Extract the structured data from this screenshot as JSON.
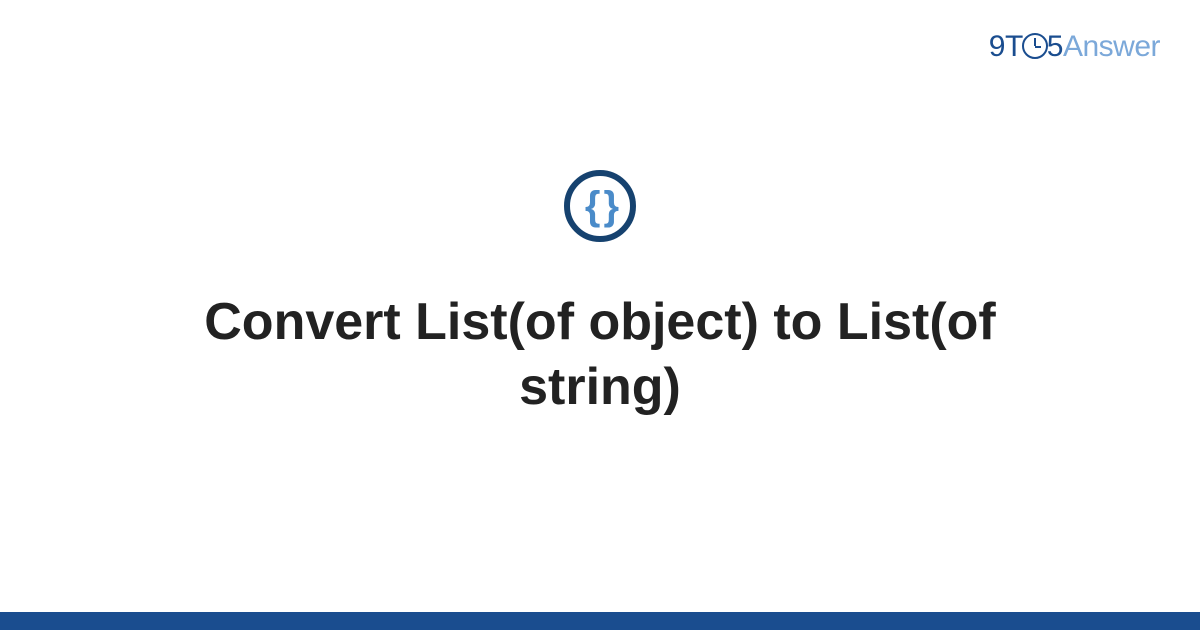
{
  "brand": {
    "part1": "9",
    "part2": "T",
    "part3": "5",
    "part4": "Answer"
  },
  "category_icon": {
    "symbol": "{ }",
    "name": "code-braces"
  },
  "title": "Convert List(of object) to List(of string)",
  "colors": {
    "brand_primary": "#1a4d8f",
    "brand_secondary": "#7ba8d9",
    "icon_border": "#16426f",
    "icon_fill": "#4a8bc9",
    "text": "#222222"
  }
}
